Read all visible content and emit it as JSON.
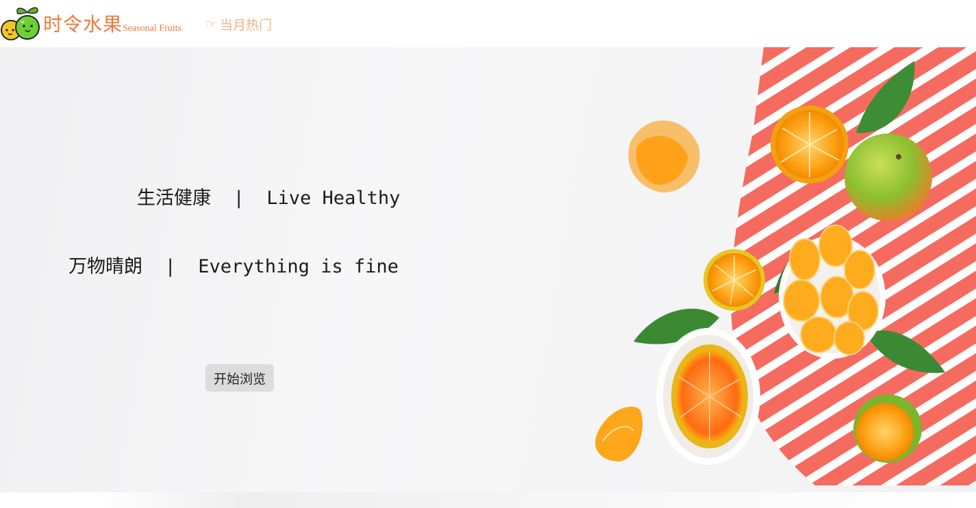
{
  "header": {
    "logo_icon": "lime-and-lemon-mascot-icon",
    "brand_cn": "时令水果",
    "brand_en": "Seasonal Fruits",
    "hot_icon": "pointing-hand-icon",
    "hot_glyph": "☞",
    "hot_label": "当月热门",
    "colors": {
      "brand": "#ee7a3a",
      "link": "#f2b27f"
    }
  },
  "hero": {
    "line1": "生活健康  |  Live Healthy",
    "line2": "万物晴朗  |  Everything is fine",
    "start_button": "开始浏览",
    "image_subject": "oranges-and-limes-on-striped-red-napkin"
  }
}
